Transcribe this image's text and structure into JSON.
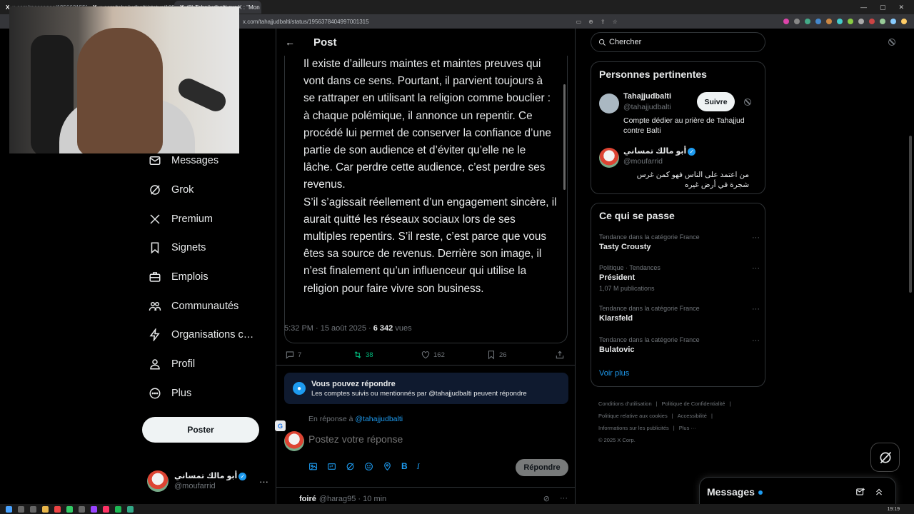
{
  "browser": {
    "tabs": [
      {
        "icon": "X",
        "title": "x.com/messages/1956631553077"
      },
      {
        "icon": "X",
        "title": "x.com/tahajjudbalti/status/19560"
      },
      {
        "icon": "X",
        "title": "(8) Tahajjudbalti sur X : \"Mon av"
      }
    ],
    "url": "x.com/tahajjudbalti/status/1956378404997001315",
    "time": "19:19"
  },
  "nav": {
    "items": [
      {
        "name": "messages",
        "label": "Messages",
        "icon": "envelope-icon"
      },
      {
        "name": "grok",
        "label": "Grok",
        "icon": "grok-icon"
      },
      {
        "name": "premium",
        "label": "Premium",
        "icon": "x-logo-icon"
      },
      {
        "name": "signets",
        "label": "Signets",
        "icon": "bookmark-icon"
      },
      {
        "name": "emplois",
        "label": "Emplois",
        "icon": "briefcase-icon"
      },
      {
        "name": "communautes",
        "label": "Communautés",
        "icon": "people-icon"
      },
      {
        "name": "organisations",
        "label": "Organisations certifiées",
        "icon": "lightning-icon"
      },
      {
        "name": "profil",
        "label": "Profil",
        "icon": "person-icon"
      },
      {
        "name": "plus",
        "label": "Plus",
        "icon": "more-circle-icon"
      }
    ],
    "post_button": "Poster",
    "account": {
      "name": "أبو مالك تمساني",
      "handle": "@moufarrid"
    }
  },
  "post": {
    "header_title": "Post",
    "paragraphs": [
      "Il existe d’ailleurs maintes et maintes preuves qui vont dans ce sens. Pourtant, il parvient toujours à se rattraper en utilisant la religion comme bouclier : à chaque polémique, il annonce un repentir. Ce procédé lui permet de conserver la confiance d’une partie de son audience et d’éviter qu’elle ne le lâche. Car perdre cette audience, c’est perdre ses revenus.",
      "S’il s’agissait réellement d’un engagement sincère, il aurait quitté les réseaux sociaux lors de ses multiples repentirs. S’il reste, c’est parce que vous êtes sa source de revenus. Derrière son image, il n’est finalement qu’un influenceur qui utilise la religion pour faire vivre son business."
    ],
    "timestamp": "5:32 PM · 15 août 2025 · ",
    "views_count": "6 342",
    "views_label": " vues",
    "stats": {
      "replies": "7",
      "reposts": "38",
      "likes": "162",
      "bookmarks": "26"
    }
  },
  "reply_notice": {
    "title": "Vous pouvez répondre",
    "subtitle": "Les comptes suivis ou mentionnés par @tahajjudbalti peuvent répondre"
  },
  "composer": {
    "in_reply_prefix": "En réponse à ",
    "in_reply_handle": "@tahajjudbalti",
    "placeholder": "Postez votre réponse",
    "bold_label": "B",
    "italic_label": "I",
    "reply_button": "Répondre"
  },
  "next_reply": {
    "name": "foiré",
    "meta": "@harag95 · 10 min"
  },
  "search": {
    "placeholder": "Chercher"
  },
  "relevant_people": {
    "title": "Personnes pertinentes",
    "people": [
      {
        "name": "Tahajjudbalti",
        "handle": "@tahajjudbalti",
        "bio": "Compte dédier au prière de Tahajjud contre Balti",
        "follow": "Suivre"
      },
      {
        "name": "أبو مالك تمساني",
        "handle": "@moufarrid",
        "bio": "من اعتمد على الناس فهو كمن غرس شجرة في أرض غيره"
      }
    ]
  },
  "trends": {
    "title": "Ce qui se passe",
    "items": [
      {
        "category": "Tendance dans la catégorie France",
        "name": "Tasty Crousty",
        "count": ""
      },
      {
        "category": "Politique · Tendances",
        "name": "Président",
        "count": "1,07 M publications"
      },
      {
        "category": "Tendance dans la catégorie France",
        "name": "Klarsfeld",
        "count": ""
      },
      {
        "category": "Tendance dans la catégorie France",
        "name": "Bulatovic",
        "count": ""
      }
    ],
    "show_more": "Voir plus"
  },
  "footer": {
    "links": [
      "Conditions d’utilisation",
      "Politique de Confidentialité",
      "Politique relative aux cookies",
      "Accessibilité",
      "Informations sur les publicités",
      "Plus ···"
    ],
    "copyright": "© 2025 X Corp."
  },
  "messages_drawer": {
    "title": "Messages"
  }
}
